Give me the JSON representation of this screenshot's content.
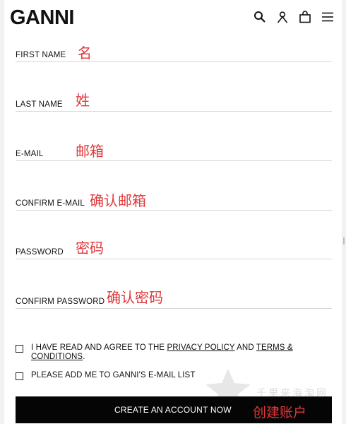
{
  "header": {
    "logo": "GANNI",
    "icons": [
      "search-icon",
      "account-icon",
      "bag-icon",
      "menu-icon"
    ]
  },
  "form": {
    "first_name": {
      "label": "FIRST NAME",
      "annotation": "名"
    },
    "last_name": {
      "label": "LAST NAME",
      "annotation": "姓"
    },
    "email": {
      "label": "E-MAIL",
      "annotation": "邮箱"
    },
    "confirm_email": {
      "label": "CONFIRM E-MAIL",
      "annotation": "确认邮箱"
    },
    "password": {
      "label": "PASSWORD",
      "annotation": "密码"
    },
    "confirm_password": {
      "label": "CONFIRM PASSWORD",
      "annotation": "确认密码"
    }
  },
  "agree": {
    "pre": "I HAVE READ AND AGREE TO THE ",
    "privacy": "PRIVACY POLICY",
    "mid": " AND ",
    "terms": "TERMS & CONDITIONS",
    "post": "."
  },
  "newsletter": {
    "label": "PLEASE ADD ME TO GANNI'S E-MAIL LIST"
  },
  "cta": {
    "label": "CREATE AN ACCOUNT NOW",
    "annotation": "创建账户"
  },
  "watermark": {
    "text": "千里来海淘网"
  },
  "colors": {
    "annotation": "#e0383a",
    "button": "#050505"
  }
}
